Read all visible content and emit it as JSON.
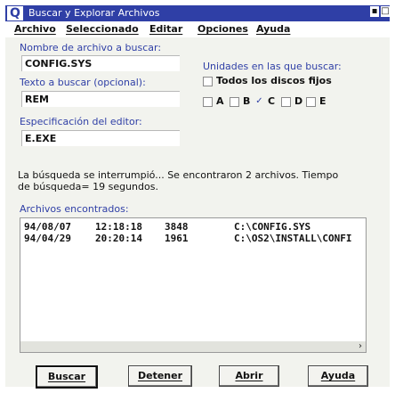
{
  "window": {
    "title": "Buscar y Explorar Archivos",
    "icon": "Q",
    "controls": {
      "minimize": "▪",
      "maximize": "□"
    }
  },
  "menu": {
    "items": [
      "Archivo",
      "Seleccionado",
      "Editar",
      "Opciones",
      "Ayuda"
    ]
  },
  "form": {
    "filename_label": "Nombre de archivo a buscar:",
    "filename_value": "CONFIG.SYS",
    "text_label": "Texto a buscar (opcional):",
    "text_value": "REM",
    "editor_label": "Especificación del editor:",
    "editor_value": "E.EXE"
  },
  "drives": {
    "label": "Unidades en las que buscar:",
    "all_fixed": {
      "label": "Todos los discos fijos",
      "checked": false
    },
    "list": [
      {
        "letter": "A",
        "checked": false
      },
      {
        "letter": "B",
        "checked": false
      },
      {
        "letter": "C",
        "checked": true
      },
      {
        "letter": "D",
        "checked": false
      },
      {
        "letter": "E",
        "checked": false
      }
    ]
  },
  "status": {
    "line1": "La búsqueda se interrumpió... Se encontraron 2 archivos. Tiempo",
    "line2": "de búsqueda= 19 segundos."
  },
  "results": {
    "label": "Archivos encontrados:",
    "rows": [
      {
        "date": "94/08/07",
        "time": "12:18:18",
        "size": "3848",
        "path": "C:\\CONFIG.SYS"
      },
      {
        "date": "94/04/29",
        "time": "20:20:14",
        "size": "1961",
        "path": "C:\\OS2\\INSTALL\\CONFI("
      }
    ],
    "scroll_right": "›"
  },
  "buttons": {
    "search": "Buscar",
    "stop": "Detener",
    "open": "Abrir",
    "help": "Ayuda"
  },
  "colors": {
    "title_bg": "#2f3fa6",
    "label_blue": "#2f3fa6",
    "window_bg": "#f2f3ee"
  }
}
